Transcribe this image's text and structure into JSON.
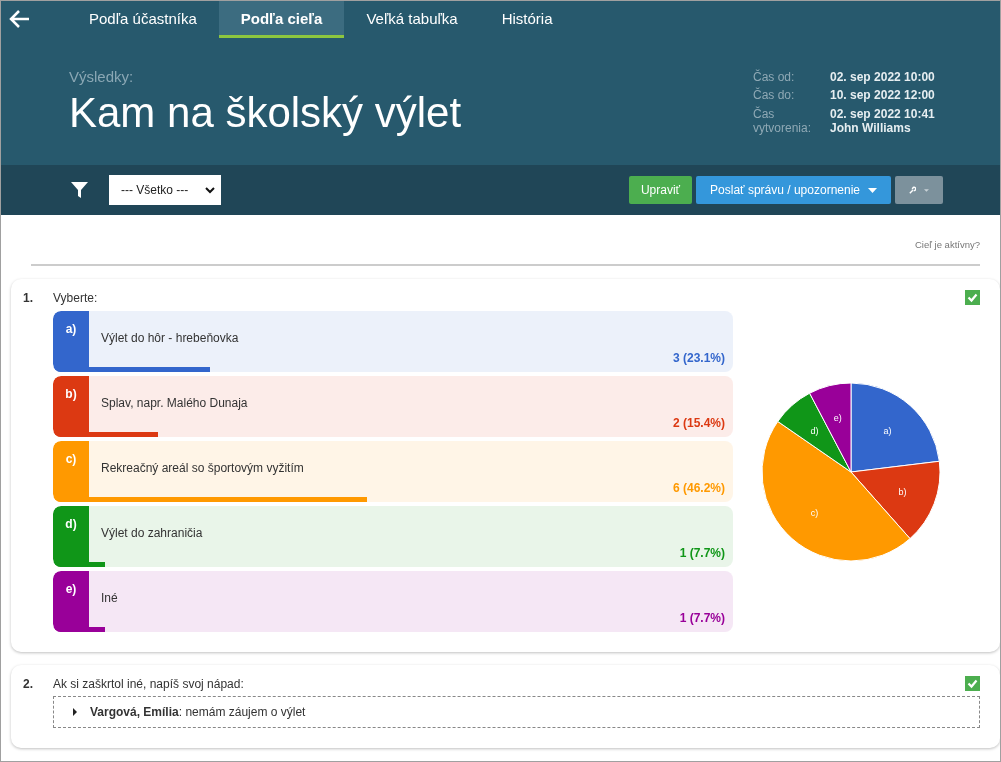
{
  "nav": {
    "tabs": [
      {
        "label": "Podľa účastníka",
        "selected": false
      },
      {
        "label": "Podľa cieľa",
        "selected": true
      },
      {
        "label": "Veľká tabuľka",
        "selected": false
      },
      {
        "label": "História",
        "selected": false
      }
    ]
  },
  "header": {
    "caption": "Výsledky:",
    "title": "Kam na školský výlet",
    "meta": [
      {
        "label": "Čas od:",
        "values": [
          "02. sep 2022 10:00"
        ]
      },
      {
        "label": "Čas do:",
        "values": [
          "10. sep 2022 12:00"
        ]
      },
      {
        "label": "Čas vytvorenia:",
        "values": [
          "02. sep 2022 10:41",
          "John Williams"
        ]
      }
    ]
  },
  "toolbar": {
    "filter": {
      "value": "--- Všetko ---"
    },
    "buttons": [
      {
        "kind": "edit",
        "label": "Upraviť"
      },
      {
        "kind": "dropdown",
        "label": "Poslať správu / upozornenie"
      },
      {
        "kind": "tools"
      }
    ]
  },
  "active_question": "Cieľ je aktívny?",
  "questions": [
    {
      "kind": "choice",
      "number": "1.",
      "text": "Vyberte:",
      "checked": true,
      "options": [
        {
          "letter": "a)",
          "text": "Výlet do hôr - hrebeňovka",
          "count": "3 (23.1%)",
          "level": 0.231,
          "color": "#3366cc"
        },
        {
          "letter": "b)",
          "text": "Splav, napr. Malého Dunaja",
          "count": "2 (15.4%)",
          "level": 0.154,
          "color": "#dc3912"
        },
        {
          "letter": "c)",
          "text": "Rekreačný areál so športovým vyžitím",
          "count": "6 (46.2%)",
          "level": 0.462,
          "color": "#ff9900"
        },
        {
          "letter": "d)",
          "text": "Výlet do zahraničia",
          "count": "1 (7.7%)",
          "level": 0.077,
          "color": "#109618"
        },
        {
          "letter": "e)",
          "text": "Iné",
          "count": "1 (7.7%)",
          "level": 0.077,
          "color": "#990099"
        }
      ],
      "chart_data": {
        "type": "pie",
        "categories": [
          "a)",
          "b)",
          "c)",
          "d)",
          "e)"
        ],
        "values": [
          23.1,
          15.4,
          46.2,
          7.7,
          7.7
        ]
      }
    },
    {
      "kind": "text",
      "number": "2.",
      "text": "Ak si zaškrtol iné, napíš svoj nápad:",
      "checked": true,
      "responses": [
        {
          "name": "Vargová, Emília",
          "text": ": nemám záujem o výlet",
          "expanded": false
        }
      ]
    }
  ]
}
